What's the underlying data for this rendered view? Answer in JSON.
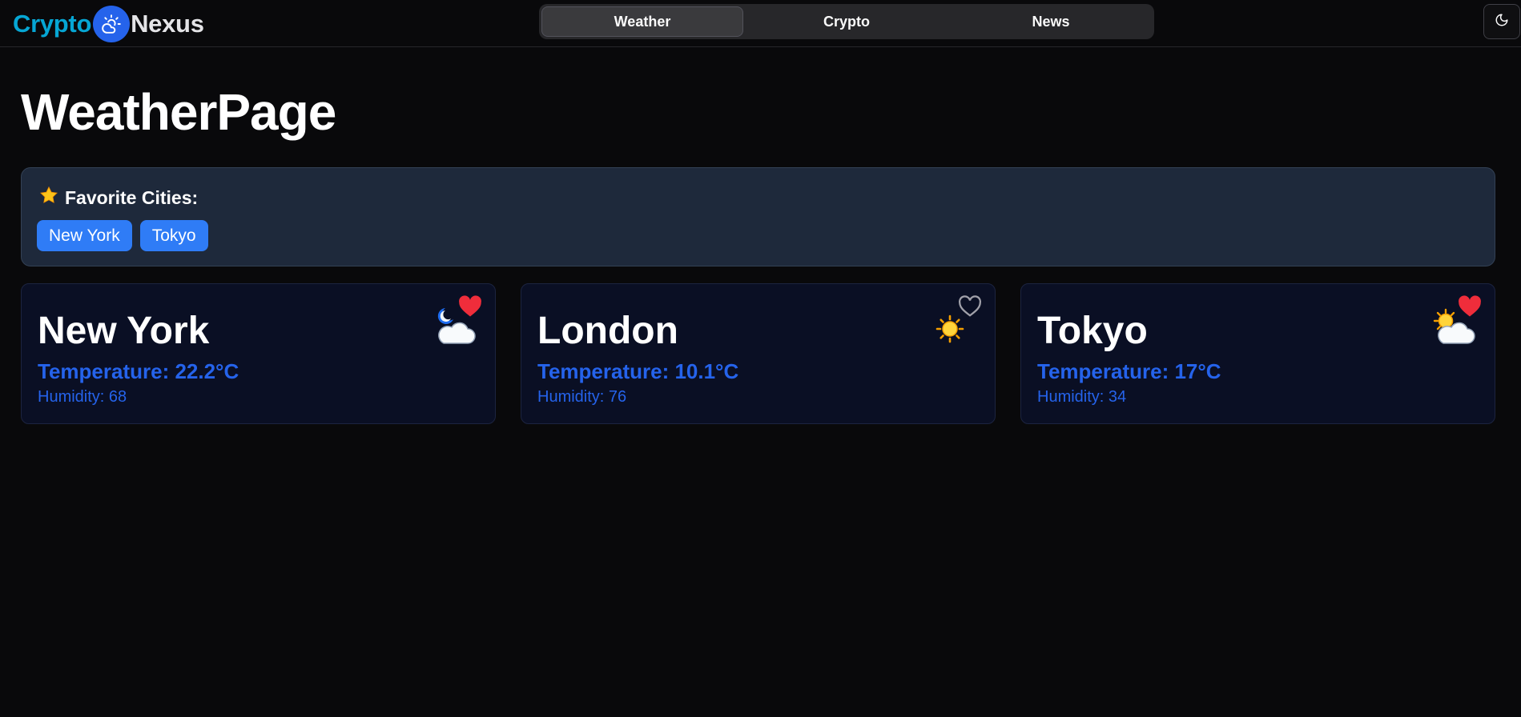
{
  "app": {
    "brand_part1": "Crypto",
    "brand_part2": "Nexus",
    "brand_icon": "cloud-sun-icon",
    "brand_colors": {
      "part1": "#06a6d4",
      "badge": "#2563eb"
    }
  },
  "nav": {
    "tabs": [
      {
        "label": "Weather",
        "active": true
      },
      {
        "label": "Crypto",
        "active": false
      },
      {
        "label": "News",
        "active": false
      }
    ]
  },
  "theme_toggle": {
    "icon": "moon-icon"
  },
  "page": {
    "title": "WeatherPage"
  },
  "favorites": {
    "icon": "star-icon",
    "heading": "Favorite Cities:",
    "cities": [
      "New York",
      "Tokyo"
    ]
  },
  "cards": [
    {
      "city": "New York",
      "temperature": "Temperature: 22.2°C",
      "humidity": "Humidity: 68",
      "icon": "cloud-moon-icon",
      "favorite": true
    },
    {
      "city": "London",
      "temperature": "Temperature: 10.1°C",
      "humidity": "Humidity: 76",
      "icon": "sun-icon",
      "favorite": false
    },
    {
      "city": "Tokyo",
      "temperature": "Temperature: 17°C",
      "humidity": "Humidity: 34",
      "icon": "sun-behind-cloud-icon",
      "favorite": true
    }
  ],
  "colors": {
    "background": "#09090b",
    "accent": "#2563eb",
    "chip": "#2f7cf6",
    "favorites_panel": "#1e293b",
    "card": "#0a0f24",
    "heart_active": "#ef2d3b",
    "heart_inactive": "#a1a1aa"
  }
}
